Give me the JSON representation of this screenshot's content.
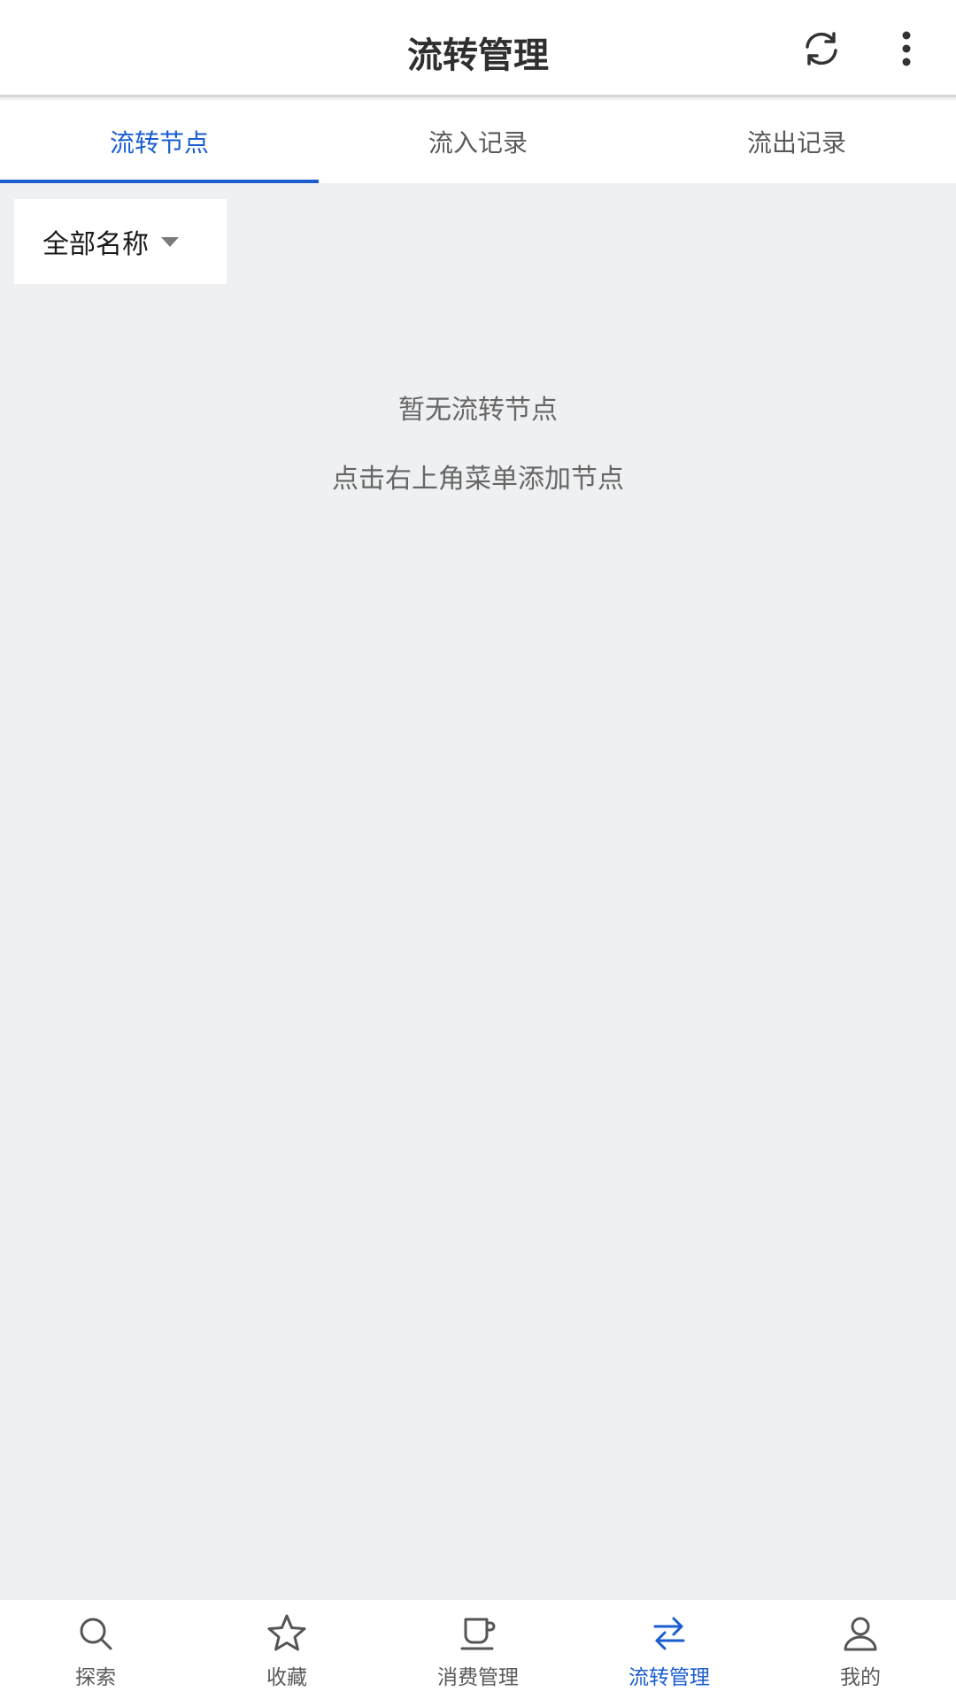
{
  "header": {
    "title": "流转管理",
    "actions": [
      {
        "icon": "sync-icon"
      },
      {
        "icon": "more-vertical-icon"
      }
    ]
  },
  "tabs": [
    {
      "label": "流转节点",
      "active": true
    },
    {
      "label": "流入记录",
      "active": false
    },
    {
      "label": "流出记录",
      "active": false
    }
  ],
  "filter": {
    "label": "全部名称",
    "icon": "caret-down-icon"
  },
  "empty_state": {
    "title": "暂无流转节点",
    "hint": "点击右上角菜单添加节点"
  },
  "bottom_nav": [
    {
      "label": "探索",
      "icon": "search-icon",
      "active": false
    },
    {
      "label": "收藏",
      "icon": "star-icon",
      "active": false
    },
    {
      "label": "消费管理",
      "icon": "cup-icon",
      "active": false
    },
    {
      "label": "流转管理",
      "icon": "transfer-icon",
      "active": true
    },
    {
      "label": "我的",
      "icon": "user-icon",
      "active": false
    }
  ],
  "colors": {
    "accent": "#1b5dd0",
    "background": "#eff0f2",
    "surface": "#ffffff",
    "text_secondary": "#666666"
  }
}
